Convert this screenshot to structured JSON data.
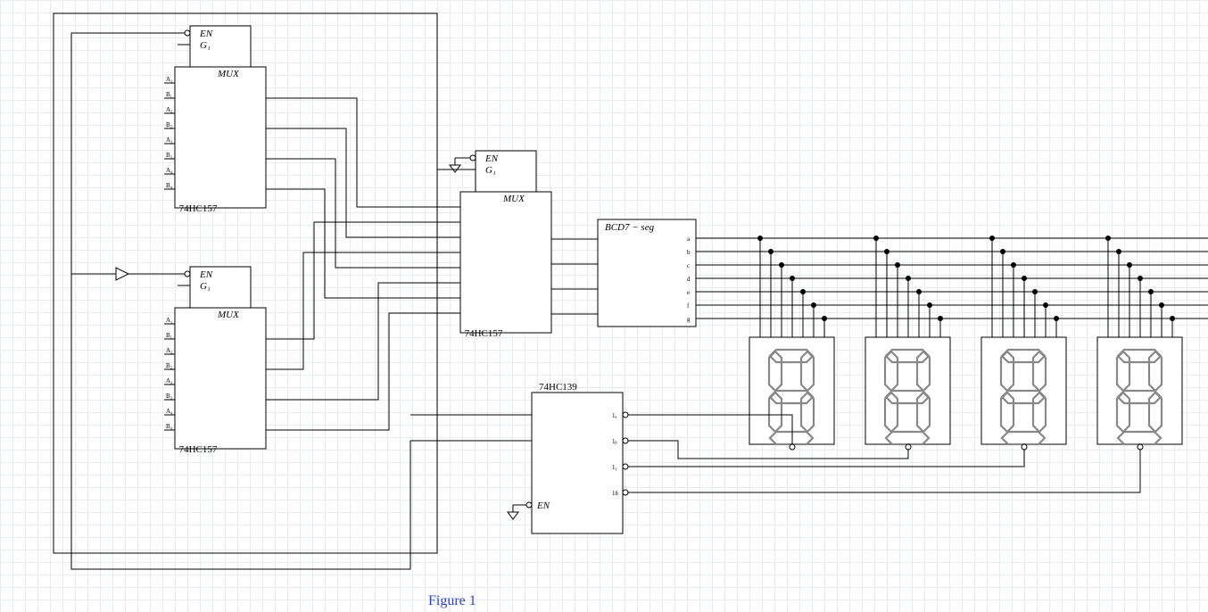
{
  "caption": "Figure 1",
  "mux": {
    "title": "MUX",
    "part": "74HC157",
    "en": "EN",
    "g1": "G₁",
    "pins": [
      "A₁",
      "B₁",
      "A₂",
      "B₂",
      "A₃",
      "B₃",
      "A₄",
      "B₄"
    ]
  },
  "decoder": {
    "part": "74HC139",
    "en": "EN",
    "out": [
      "1ₐ",
      "1ᵦ",
      "1ᵧ",
      "1δ"
    ]
  },
  "bcd": {
    "title": "BCD7 − seg",
    "out": [
      "a",
      "b",
      "c",
      "d",
      "e",
      "f",
      "g"
    ]
  }
}
